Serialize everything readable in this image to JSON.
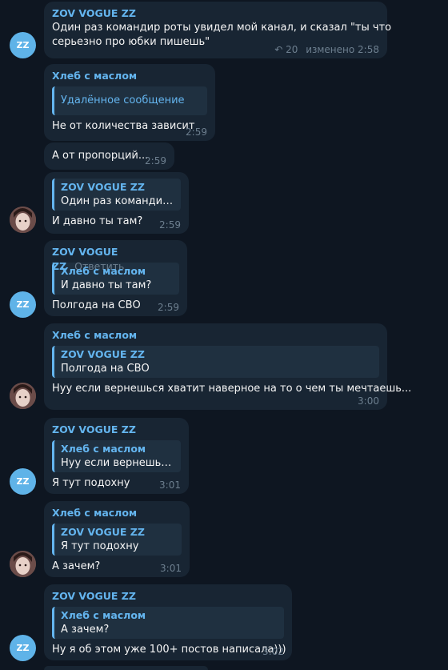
{
  "messages": [
    {
      "sender": "ZOV VOGUE ZZ",
      "text_lines": [
        "Один раз командир роты увидел мой канал, и сказал \"ты что",
        "серьезно про юбки пишешь\""
      ],
      "replies_count": "20",
      "edited": "изменено",
      "time": "2:58"
    },
    {
      "sender": "Хлеб с маслом",
      "quote_text": "Удалённое сообщение",
      "text": "Не от количества зависит",
      "time": "2:59"
    },
    {
      "text": "А от пропорций...",
      "time": "2:59"
    },
    {
      "quote_sender": "ZOV VOGUE ZZ",
      "quote_text": "Один раз командир р...",
      "text": "И давно ты там?",
      "time": "2:59"
    },
    {
      "sender": "ZOV VOGUE ZZ",
      "reply_label": "Ответить",
      "quote_sender": "Хлеб с маслом",
      "quote_text": "И давно ты там?",
      "text": "Полгода на СВО",
      "time": "2:59"
    },
    {
      "sender": "Хлеб с маслом",
      "quote_sender": "ZOV VOGUE ZZ",
      "quote_text": "Полгода на СВО",
      "text": "Нуу если вернешься хватит наверное на то о чем ты мечтаешь...",
      "time": "3:00"
    },
    {
      "sender": "ZOV VOGUE ZZ",
      "quote_sender": "Хлеб с маслом",
      "quote_text": "Нуу если вернешься ...",
      "text": "Я тут подохну",
      "time": "3:01"
    },
    {
      "sender": "Хлеб с маслом",
      "quote_sender": "ZOV VOGUE ZZ",
      "quote_text": "Я тут подохну",
      "text": "А зачем?",
      "time": "3:01"
    },
    {
      "sender": "ZOV VOGUE ZZ",
      "quote_sender": "Хлеб с маслом",
      "quote_text": "А зачем?",
      "text": "Ну я об этом уже 100+ постов написала)))",
      "time": "3:02"
    }
  ],
  "avatar_initials": "ZZ",
  "colors": {
    "background": "#0e1621",
    "bubble": "#182533",
    "accent": "#64b5ef",
    "meta": "#6d7f8f"
  }
}
